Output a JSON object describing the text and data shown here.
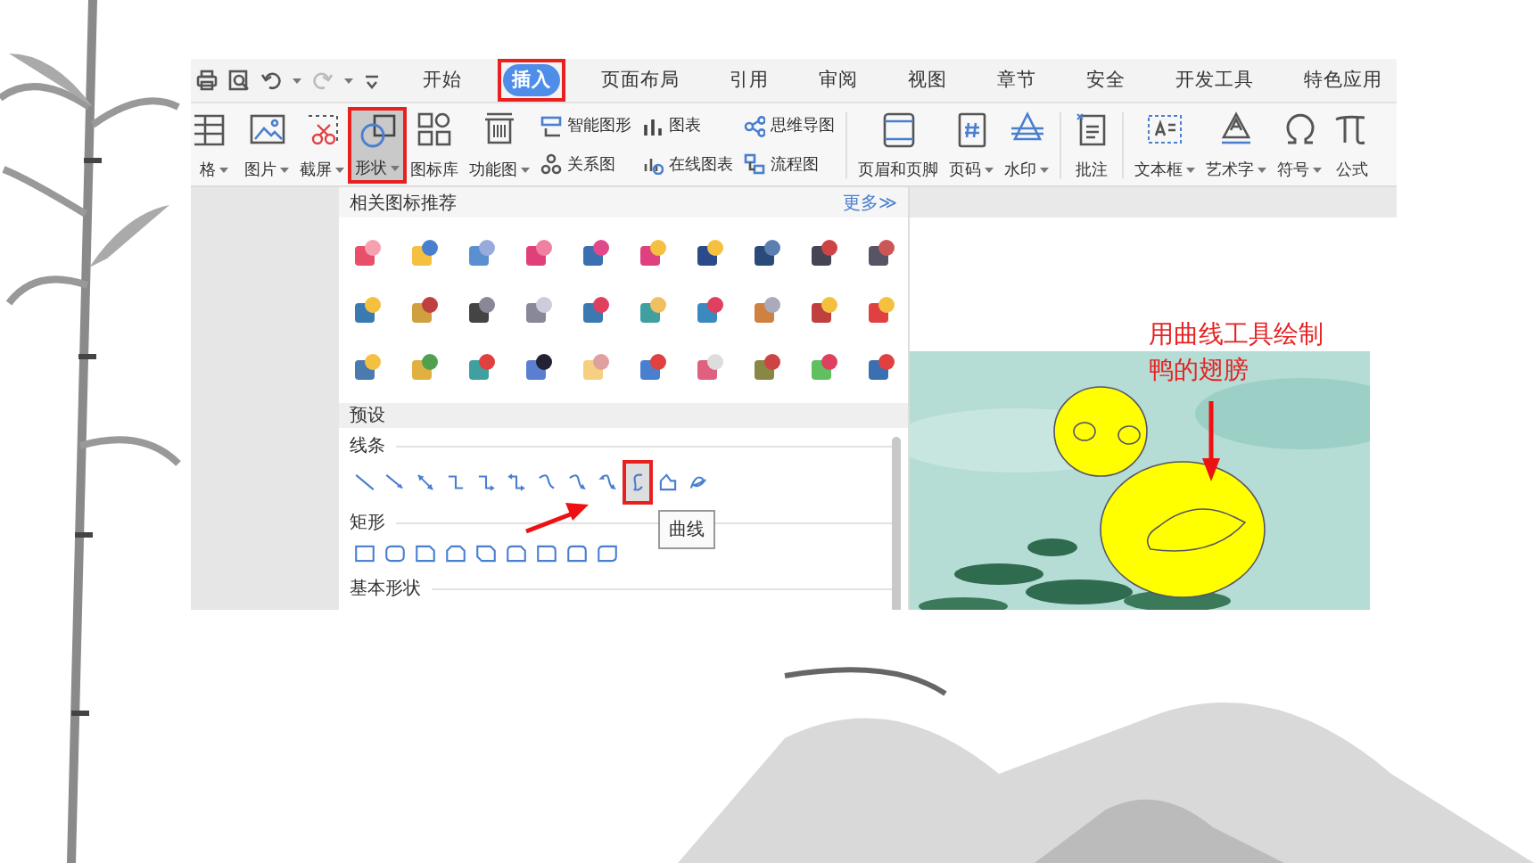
{
  "tabs": [
    {
      "label": "开始",
      "selected": false,
      "highlighted": false
    },
    {
      "label": "插入",
      "selected": true,
      "highlighted": true
    },
    {
      "label": "页面布局",
      "selected": false,
      "highlighted": false
    },
    {
      "label": "引用",
      "selected": false,
      "highlighted": false
    },
    {
      "label": "审阅",
      "selected": false,
      "highlighted": false
    },
    {
      "label": "视图",
      "selected": false,
      "highlighted": false
    },
    {
      "label": "章节",
      "selected": false,
      "highlighted": false
    },
    {
      "label": "安全",
      "selected": false,
      "highlighted": false
    },
    {
      "label": "开发工具",
      "selected": false,
      "highlighted": false
    },
    {
      "label": "特色应用",
      "selected": false,
      "highlighted": false
    }
  ],
  "ribbon": [
    {
      "kind": "large",
      "label": "格",
      "dropdown": true,
      "selected": false,
      "highlighted": false
    },
    {
      "kind": "large",
      "label": "图片",
      "dropdown": true,
      "selected": false,
      "highlighted": false
    },
    {
      "kind": "large",
      "label": "截屏",
      "dropdown": true,
      "selected": false,
      "highlighted": false
    },
    {
      "kind": "large",
      "label": "形状",
      "dropdown": true,
      "selected": true,
      "highlighted": true
    },
    {
      "kind": "large",
      "label": "图标库",
      "dropdown": false,
      "selected": false,
      "highlighted": false
    },
    {
      "kind": "large",
      "label": "功能图",
      "dropdown": true,
      "selected": false,
      "highlighted": false
    },
    {
      "kind": "stack",
      "items": [
        "智能图形",
        "关系图"
      ]
    },
    {
      "kind": "stack",
      "items": [
        "图表",
        "在线图表"
      ]
    },
    {
      "kind": "stack",
      "items": [
        "思维导图",
        "流程图"
      ]
    },
    {
      "kind": "separator"
    },
    {
      "kind": "large",
      "label": "页眉和页脚",
      "dropdown": false,
      "selected": false,
      "highlighted": false
    },
    {
      "kind": "large",
      "label": "页码",
      "dropdown": true,
      "selected": false,
      "highlighted": false
    },
    {
      "kind": "large",
      "label": "水印",
      "dropdown": true,
      "selected": false,
      "highlighted": false
    },
    {
      "kind": "separator"
    },
    {
      "kind": "large",
      "label": "批注",
      "dropdown": false,
      "selected": false,
      "highlighted": false
    },
    {
      "kind": "separator"
    },
    {
      "kind": "large",
      "label": "文本框",
      "dropdown": true,
      "selected": false,
      "highlighted": false
    },
    {
      "kind": "large",
      "label": "艺术字",
      "dropdown": true,
      "selected": false,
      "highlighted": false
    },
    {
      "kind": "large",
      "label": "符号",
      "dropdown": true,
      "selected": false,
      "highlighted": false
    },
    {
      "kind": "large",
      "label": "公式",
      "dropdown": false,
      "selected": false,
      "highlighted": false
    }
  ],
  "shape_panel": {
    "title": "相关图标推荐",
    "more_link": "更多≫",
    "section": "预设",
    "groups": [
      {
        "label": "线条",
        "shapes": [
          {
            "kind": "line",
            "selected": false,
            "highlighted": false
          },
          {
            "kind": "arrow",
            "selected": false,
            "highlighted": false
          },
          {
            "kind": "double-arrow",
            "selected": false,
            "highlighted": false
          },
          {
            "kind": "elbow",
            "selected": false,
            "highlighted": false
          },
          {
            "kind": "elbow-arrow",
            "selected": false,
            "highlighted": false
          },
          {
            "kind": "elbow-double-arrow",
            "selected": false,
            "highlighted": false
          },
          {
            "kind": "curved",
            "selected": false,
            "highlighted": false
          },
          {
            "kind": "curved-arrow",
            "selected": false,
            "highlighted": false
          },
          {
            "kind": "curved-double-arrow",
            "selected": false,
            "highlighted": false
          },
          {
            "kind": "curve",
            "selected": true,
            "highlighted": true
          },
          {
            "kind": "freeform",
            "selected": false,
            "highlighted": false
          },
          {
            "kind": "scribble",
            "selected": false,
            "highlighted": false
          }
        ]
      },
      {
        "label": "矩形",
        "shapes": [
          {
            "kind": "rect",
            "selected": false,
            "highlighted": false
          },
          {
            "kind": "rounded",
            "selected": false,
            "highlighted": false
          },
          {
            "kind": "snip",
            "selected": false,
            "highlighted": false
          },
          {
            "kind": "snip-same",
            "selected": false,
            "highlighted": false
          },
          {
            "kind": "snip-diagonal",
            "selected": false,
            "highlighted": false
          },
          {
            "kind": "snip-round",
            "selected": false,
            "highlighted": false
          },
          {
            "kind": "round-one",
            "selected": false,
            "highlighted": false
          },
          {
            "kind": "round-same",
            "selected": false,
            "highlighted": false
          },
          {
            "kind": "round-diagonal",
            "selected": false,
            "highlighted": false
          }
        ]
      },
      {
        "label": "基本形状"
      }
    ],
    "tooltip": "曲线"
  },
  "annotation_lines": [
    "用曲线工具绘制",
    "鸭的翅膀"
  ]
}
